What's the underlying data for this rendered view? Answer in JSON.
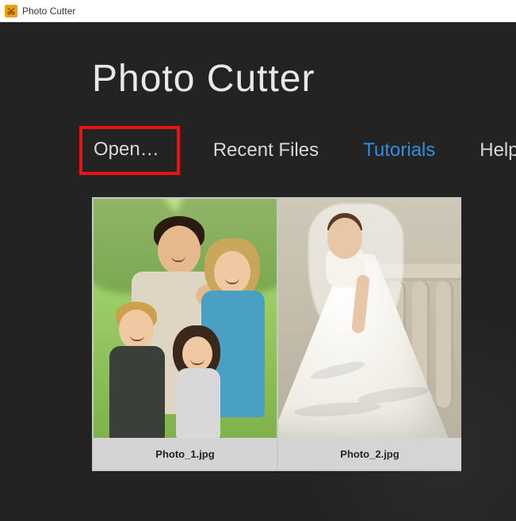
{
  "window": {
    "title": "Photo Cutter"
  },
  "app": {
    "heading": "Photo Cutter"
  },
  "menu": {
    "open": "Open…",
    "recent": "Recent Files",
    "tutorials": "Tutorials",
    "help": "Help"
  },
  "thumbs": [
    {
      "filename": "Photo_1.jpg"
    },
    {
      "filename": "Photo_2.jpg"
    }
  ],
  "highlight": {
    "target": "open"
  }
}
